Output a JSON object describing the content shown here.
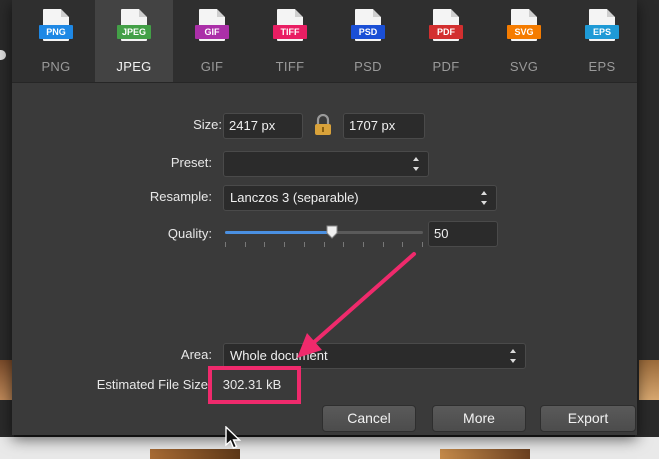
{
  "formats": [
    {
      "label": "PNG",
      "badge": "PNG",
      "color": "#1e88e5",
      "selected": false
    },
    {
      "label": "JPEG",
      "badge": "JPEG",
      "color": "#43a047",
      "selected": true
    },
    {
      "label": "GIF",
      "badge": "GIF",
      "color": "#ab2fa8",
      "selected": false
    },
    {
      "label": "TIFF",
      "badge": "TIFF",
      "color": "#e91e63",
      "selected": false
    },
    {
      "label": "PSD",
      "badge": "PSD",
      "color": "#1a4fd6",
      "selected": false
    },
    {
      "label": "PDF",
      "badge": "PDF",
      "color": "#d32f2f",
      "selected": false
    },
    {
      "label": "SVG",
      "badge": "SVG",
      "color": "#f57c00",
      "selected": false
    },
    {
      "label": "EPS",
      "badge": "EPS",
      "color": "#1e9ad6",
      "selected": false
    }
  ],
  "settings": {
    "size_label": "Size:",
    "width": "2417 px",
    "height": "1707 px",
    "preset_label": "Preset:",
    "preset_value": "",
    "resample_label": "Resample:",
    "resample_value": "Lanczos 3 (separable)",
    "quality_label": "Quality:",
    "quality_value": "50",
    "quality_fraction": 0.5,
    "area_label": "Area:",
    "area_value": "Whole document",
    "filesize_label": "Estimated File Size",
    "filesize_value": "302.31 kB"
  },
  "buttons": {
    "cancel": "Cancel",
    "more": "More",
    "export": "Export"
  },
  "colors": {
    "highlight": "#ef2a6c",
    "slider_fill": "#4a90e2"
  }
}
